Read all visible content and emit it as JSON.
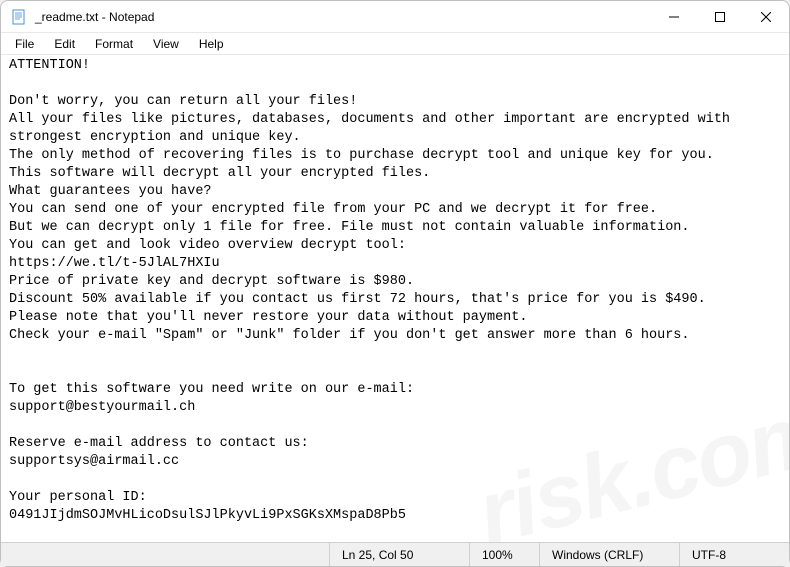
{
  "titlebar": {
    "title": "_readme.txt - Notepad"
  },
  "menubar": {
    "file": "File",
    "edit": "Edit",
    "format": "Format",
    "view": "View",
    "help": "Help"
  },
  "content": {
    "text": "ATTENTION!\n\nDon't worry, you can return all your files!\nAll your files like pictures, databases, documents and other important are encrypted with strongest encryption and unique key.\nThe only method of recovering files is to purchase decrypt tool and unique key for you.\nThis software will decrypt all your encrypted files.\nWhat guarantees you have?\nYou can send one of your encrypted file from your PC and we decrypt it for free.\nBut we can decrypt only 1 file for free. File must not contain valuable information.\nYou can get and look video overview decrypt tool:\nhttps://we.tl/t-5JlAL7HXIu\nPrice of private key and decrypt software is $980.\nDiscount 50% available if you contact us first 72 hours, that's price for you is $490.\nPlease note that you'll never restore your data without payment.\nCheck your e-mail \"Spam\" or \"Junk\" folder if you don't get answer more than 6 hours.\n\n\nTo get this software you need write on our e-mail:\nsupport@bestyourmail.ch\n\nReserve e-mail address to contact us:\nsupportsys@airmail.cc\n\nYour personal ID:\n0491JIjdmSOJMvHLicoDsulSJlPkyvLi9PxSGKsXMspaD8Pb5"
  },
  "statusbar": {
    "position": "Ln 25, Col 50",
    "zoom": "100%",
    "lineending": "Windows (CRLF)",
    "encoding": "UTF-8"
  },
  "watermark": "risk.com"
}
